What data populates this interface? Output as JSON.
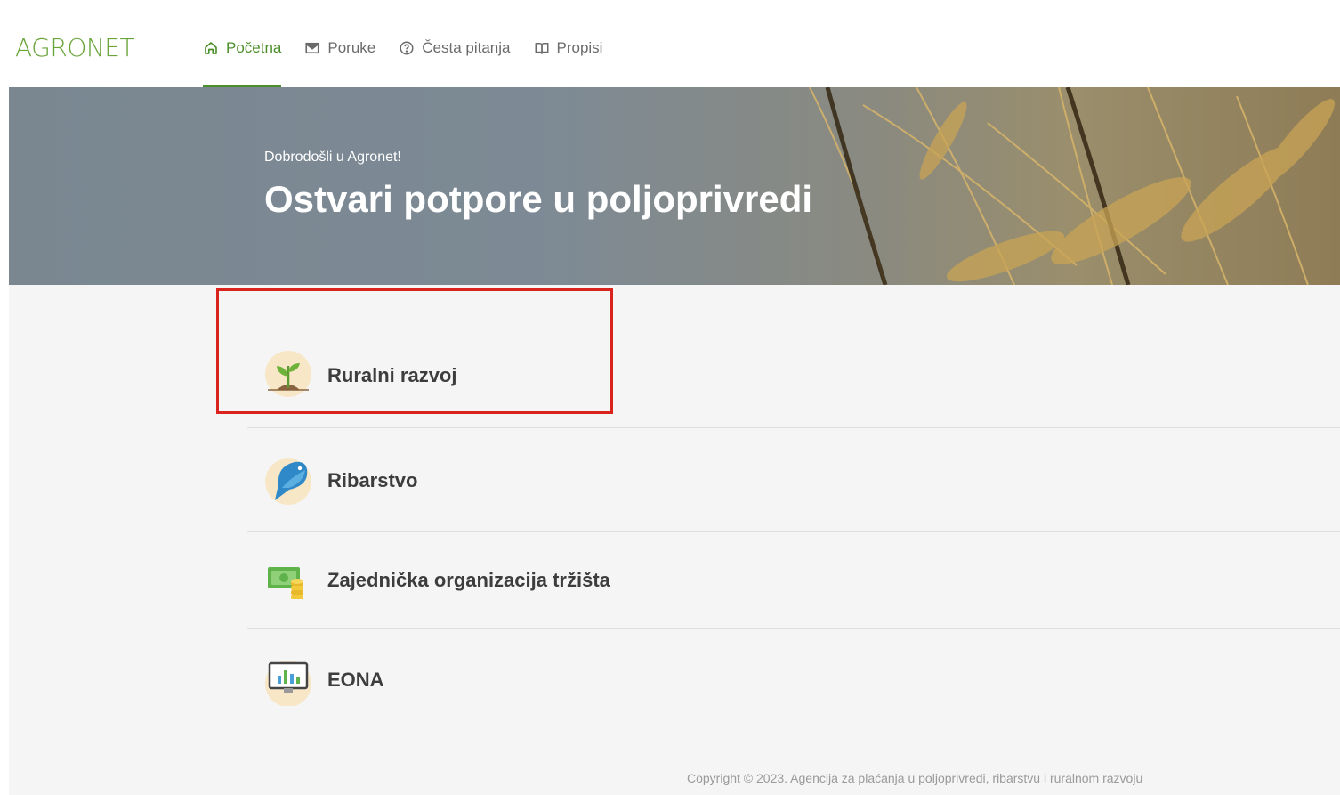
{
  "app": {
    "logo": "AGRONET"
  },
  "nav": {
    "items": [
      {
        "label": "Početna",
        "icon": "home-icon",
        "active": true
      },
      {
        "label": "Poruke",
        "icon": "mail-icon",
        "active": false
      },
      {
        "label": "Česta pitanja",
        "icon": "help-circle-icon",
        "active": false
      },
      {
        "label": "Propisi",
        "icon": "book-icon",
        "active": false
      }
    ]
  },
  "hero": {
    "subtitle": "Dobrodošli u Agronet!",
    "title": "Ostvari potpore u poljoprivredi"
  },
  "categories": [
    {
      "label": "Ruralni razvoj",
      "icon": "seedling-icon"
    },
    {
      "label": "Ribarstvo",
      "icon": "fish-icon"
    },
    {
      "label": "Zajednička organizacija tržišta",
      "icon": "money-coins-icon"
    },
    {
      "label": "EONA",
      "icon": "monitor-chart-icon"
    }
  ],
  "footer": {
    "copyright": "Copyright © 2023. Agencija za plaćanja u poljoprivredi, ribarstvu i ruralnom razvoju"
  },
  "colors": {
    "brand_green": "#4c8f2a",
    "logo_green": "#6aa53c",
    "highlight_red": "#d9231c"
  }
}
